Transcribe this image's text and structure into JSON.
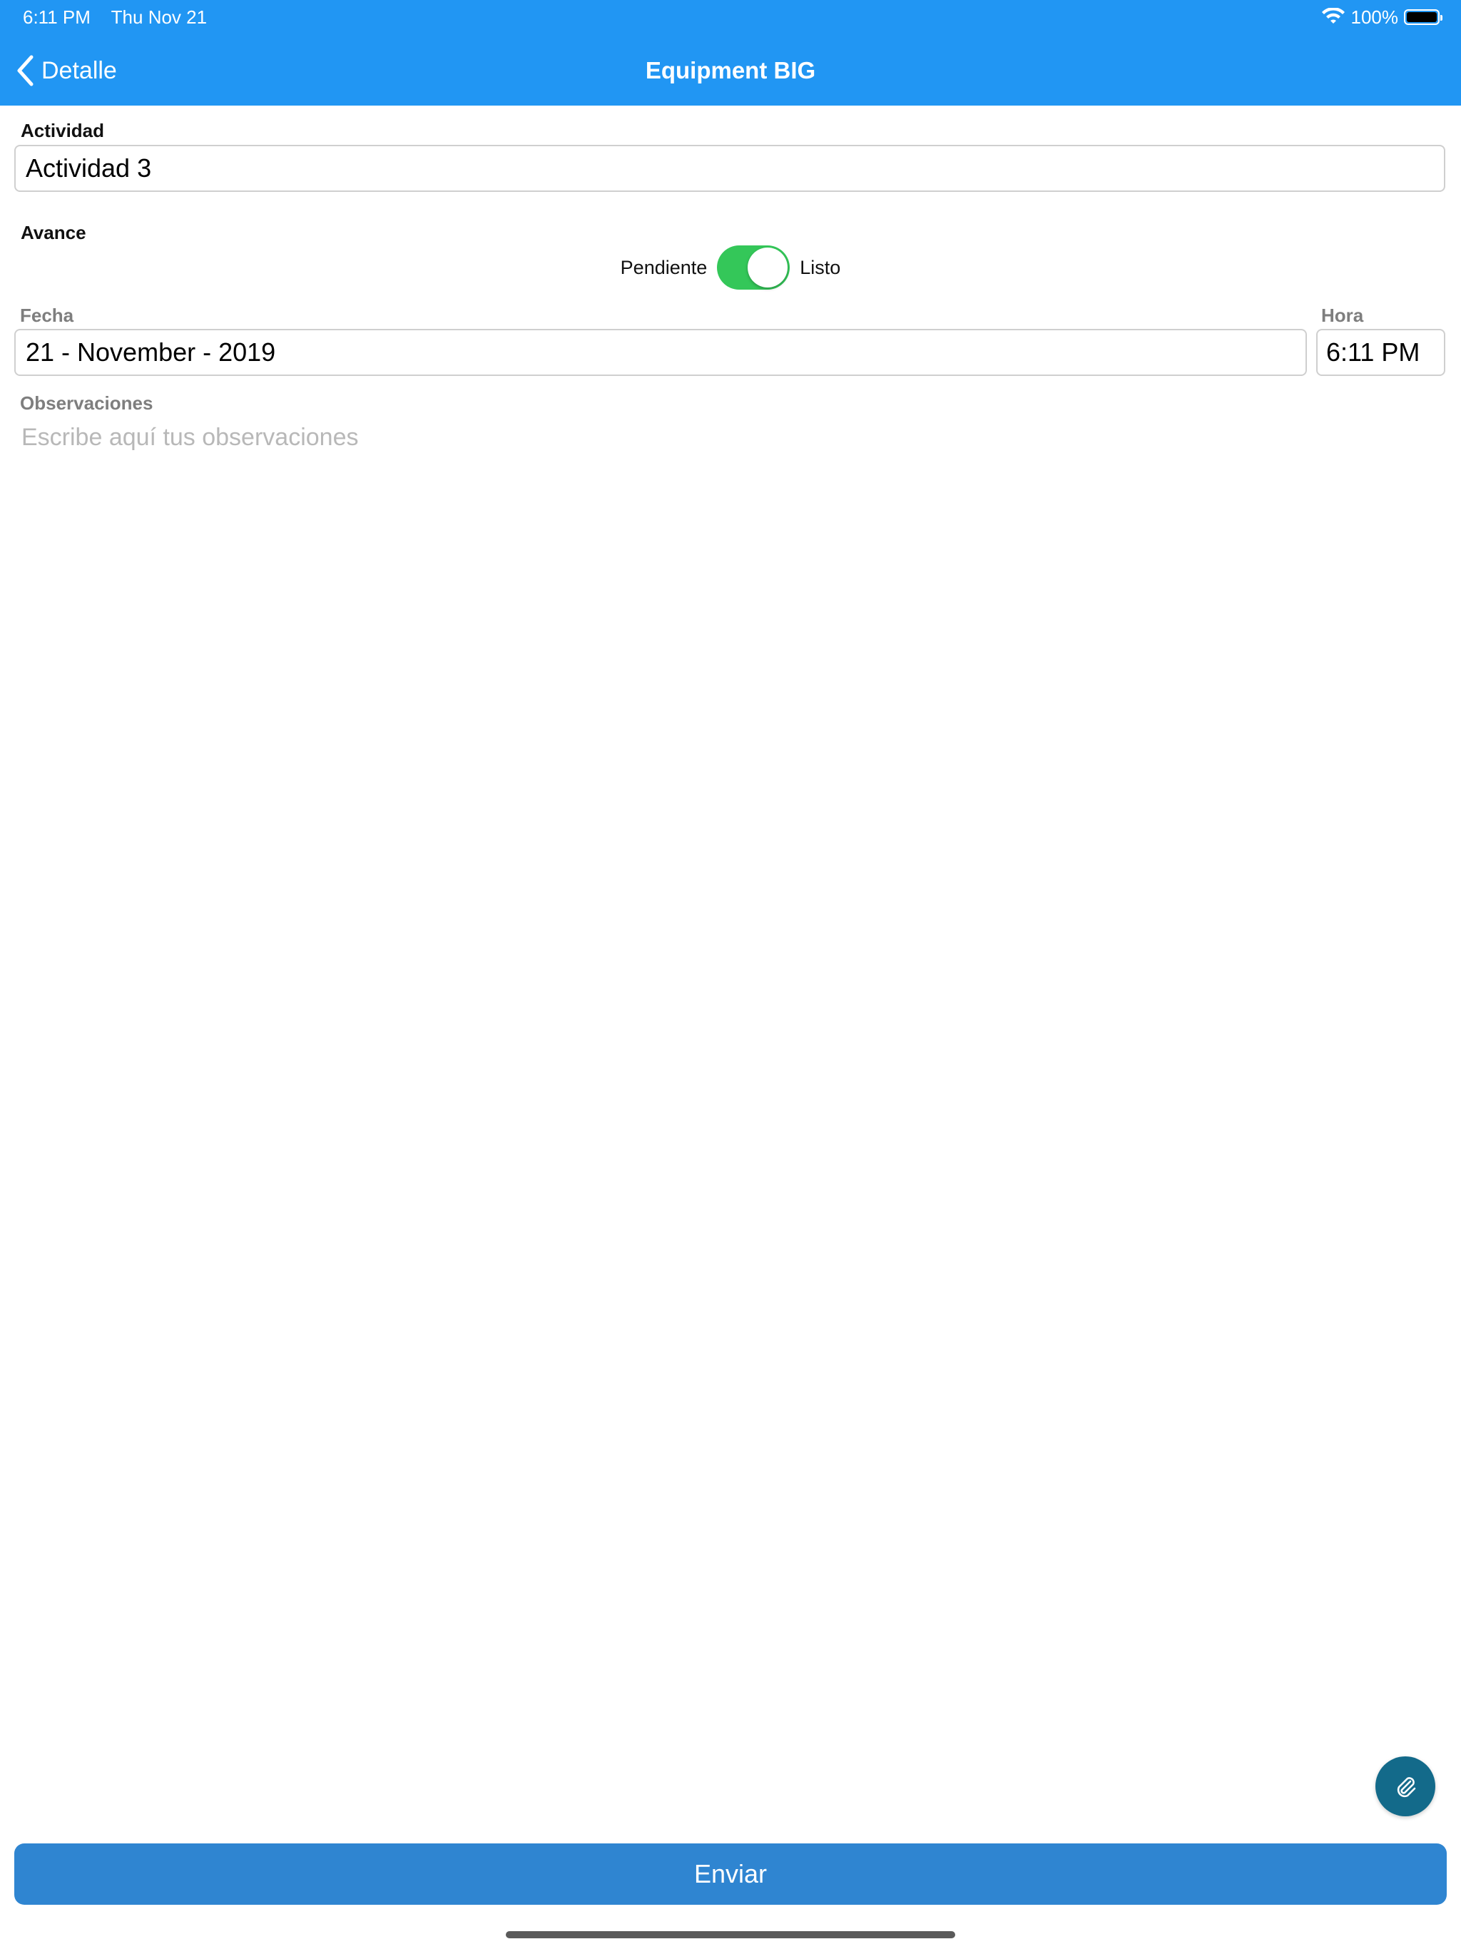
{
  "status_bar": {
    "time": "6:11 PM",
    "date": "Thu Nov 21",
    "battery": "100%"
  },
  "nav": {
    "back_label": "Detalle",
    "title": "Equipment BIG"
  },
  "form": {
    "actividad_label": "Actividad",
    "actividad_value": "Actividad 3",
    "avance_label": "Avance",
    "toggle_left_label": "Pendiente",
    "toggle_right_label": "Listo",
    "toggle_on": true,
    "fecha_label": "Fecha",
    "fecha_value": "21 - November - 2019",
    "hora_label": "Hora",
    "hora_value": "6:11 PM",
    "observaciones_label": "Observaciones",
    "observaciones_placeholder": "Escribe aquí tus observaciones"
  },
  "actions": {
    "attach_icon": "paperclip-icon",
    "submit_label": "Enviar"
  },
  "colors": {
    "header": "#2196f3",
    "toggle_on": "#34c759",
    "fab": "#136a8a",
    "submit": "#2f85d1"
  }
}
